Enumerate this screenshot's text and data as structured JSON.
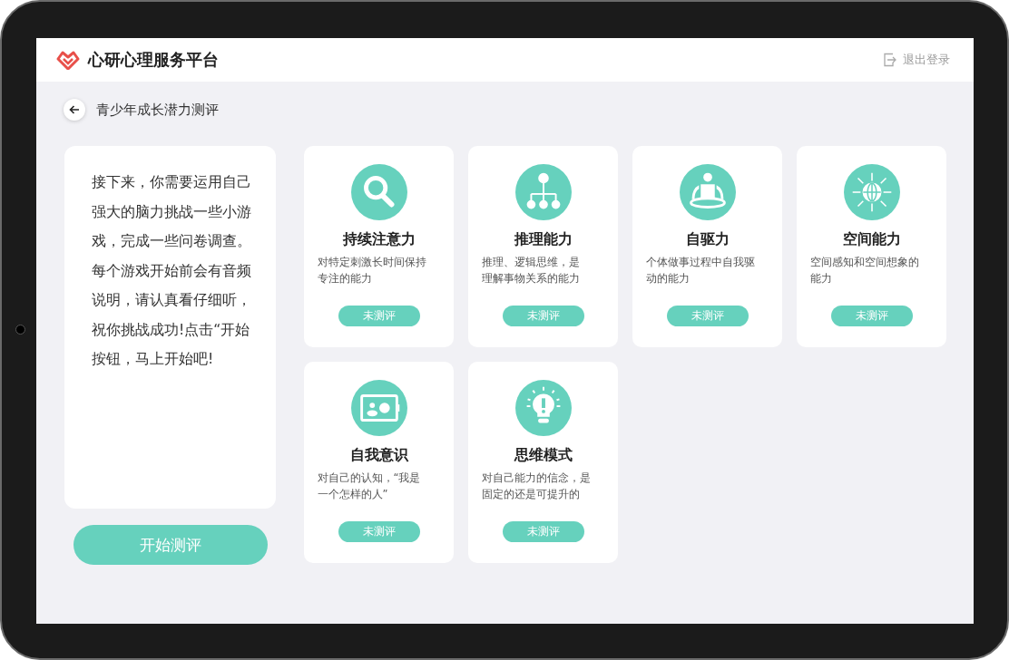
{
  "header": {
    "title": "心研心理服务平台",
    "logout": "退出登录"
  },
  "page": {
    "title": "青少年成长潜力测评"
  },
  "intro": {
    "lines": [
      "接下来，你需要运用自己",
      "强大的脑力挑战一些小游",
      "戏，完成一些问卷调查。",
      "每个游戏开始前会有音频",
      "说明，请认真看仔细听，",
      "祝你挑战成功!点击“开始",
      "按钮，马上开始吧!"
    ]
  },
  "start_button": "开始测评",
  "cards": [
    {
      "title": "持续注意力",
      "description_lines": [
        "对特定刺激长时间保持",
        "专注的能力"
      ],
      "status": "未测评"
    },
    {
      "title": "推理能力",
      "description_lines": [
        "推理、逻辑思维，是",
        "理解事物关系的能力"
      ],
      "status": "未测评"
    },
    {
      "title": "自驱力",
      "description_lines": [
        "个体做事过程中自我驱",
        "动的能力"
      ],
      "status": "未测评"
    },
    {
      "title": "空间能力",
      "description_lines": [
        "空间感知和空间想象的",
        "能力"
      ],
      "status": "未测评"
    },
    {
      "title": "自我意识",
      "description_lines": [
        "对自己的认知，“我是",
        "一个怎样的人”"
      ],
      "status": "未测评"
    },
    {
      "title": "思维模式",
      "description_lines": [
        "对自己能力的信念，是",
        "固定的还是可提升的"
      ],
      "status": "未测评"
    }
  ]
}
